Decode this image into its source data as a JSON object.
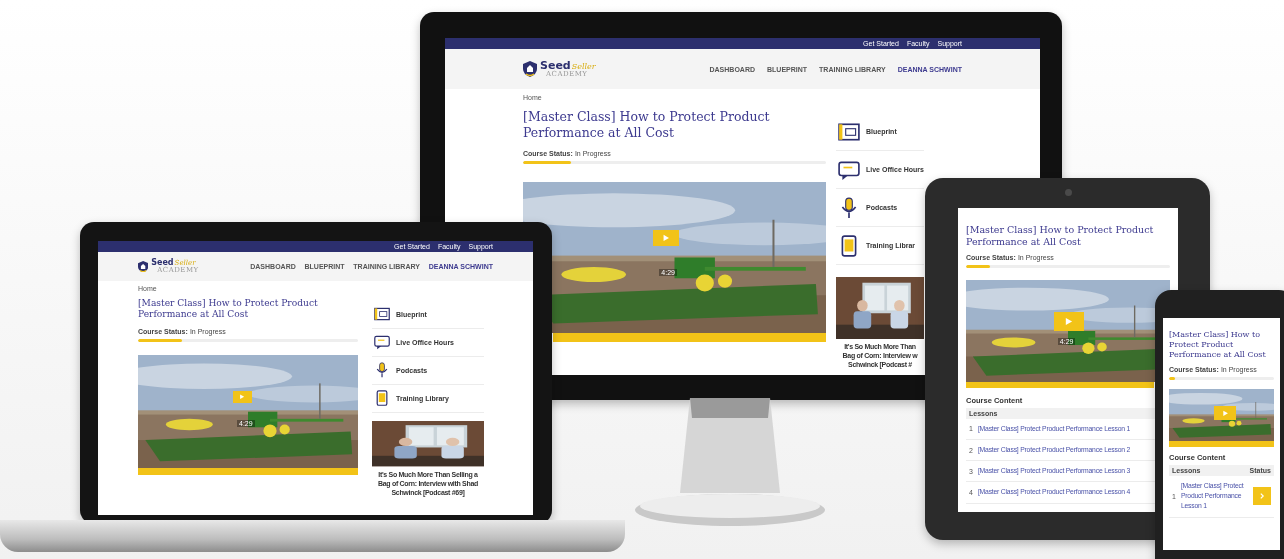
{
  "devices": [
    {
      "kind": "monitor",
      "top_links": [
        "Get Started",
        "Faculty",
        "Support"
      ],
      "logo": {
        "word": "Seed",
        "accent": "Seller",
        "sub": "ACADEMY"
      },
      "nav": [
        {
          "label": "DASHBOARD",
          "kind": "link"
        },
        {
          "label": "BLUEPRINT",
          "kind": "link"
        },
        {
          "label": "TRAINING LIBRARY",
          "kind": "link"
        },
        {
          "label": "DEANNA SCHWINT",
          "kind": "user"
        }
      ],
      "breadcrumb": "Home",
      "title": "[Master Class] How to Protect Product Performance at All Cost",
      "status_label": "Course Status:",
      "status_value": "In Progress",
      "progress": {
        "level": 0.16
      },
      "video": {
        "time": "4:29"
      },
      "sidebar": [
        {
          "kind": "blueprint",
          "label": "Blueprint"
        },
        {
          "kind": "chat",
          "label": "Live Office Hours"
        },
        {
          "kind": "mic",
          "label": "Podcasts"
        },
        {
          "kind": "tablet",
          "label": "Training Librar"
        }
      ],
      "podcast": {
        "lines": [
          "It's So Much More Than",
          "Bag of Corn: Interview w",
          "Schwinck [Podcast #"
        ]
      }
    },
    {
      "kind": "laptop",
      "top_links": [
        "Get Started",
        "Faculty",
        "Support"
      ],
      "logo": {
        "word": "Seed",
        "accent": "Seller",
        "sub": "ACADEMY"
      },
      "nav": [
        {
          "label": "DASHBOARD",
          "kind": "link"
        },
        {
          "label": "BLUEPRINT",
          "kind": "link"
        },
        {
          "label": "TRAINING LIBRARY",
          "kind": "link"
        },
        {
          "label": "DEANNA SCHWINT",
          "kind": "user"
        }
      ],
      "breadcrumb": "Home",
      "title": "[Master Class] How to Protect Product Performance at All Cost",
      "status_label": "Course Status:",
      "status_value": "In Progress",
      "progress": {
        "level": 0.2
      },
      "video": {
        "time": "4:29"
      },
      "sidebar": [
        {
          "kind": "blueprint",
          "label": "Blueprint"
        },
        {
          "kind": "chat",
          "label": "Live Office Hours"
        },
        {
          "kind": "mic",
          "label": "Podcasts"
        },
        {
          "kind": "tablet",
          "label": "Training Library"
        }
      ],
      "podcast": {
        "lines": [
          "It's So Much More Than Selling a",
          "Bag of Corn: Interview with Shad",
          "Schwinck [Podcast #69]"
        ]
      }
    },
    {
      "kind": "tablet",
      "title": "[Master Class] How to Protect Product Performance at All Cost",
      "status_label": "Course Status:",
      "status_value": "In Progress",
      "progress": {
        "level": 0.12
      },
      "video": {
        "time": "4:29"
      },
      "course_content": {
        "heading": "Course Content",
        "columns": [
          "Lessons"
        ],
        "rows": [
          {
            "num": "1",
            "label": "[Master Class] Protect Product Performance Lesson 1"
          },
          {
            "num": "2",
            "label": "[Master Class] Protect Product Performance Lesson 2"
          },
          {
            "num": "3",
            "label": "[Master Class] Protect Product Performance Lesson 3"
          },
          {
            "num": "4",
            "label": "[Master Class] Protect Product Performance Lesson 4"
          }
        ]
      }
    },
    {
      "kind": "phone",
      "title": "[Master Class] How to Protect Product Performance at All Cost",
      "status_label": "Course Status:",
      "status_value": "In Progress",
      "progress": {
        "level": 0.06
      },
      "course_content": {
        "heading": "Course Content",
        "columns": [
          "Lessons",
          "Status"
        ],
        "rows": [
          {
            "num": "1",
            "label": "[Master Class] Protect Product Performance Lesson 1",
            "button": true
          }
        ]
      }
    }
  ]
}
